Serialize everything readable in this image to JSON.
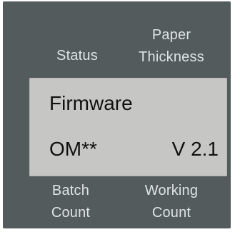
{
  "keys": {
    "status": "Status",
    "paper_thickness": [
      "Paper",
      "Thickness"
    ],
    "batch_count": [
      "Batch",
      "Count"
    ],
    "working_count": [
      "Working",
      "Count"
    ]
  },
  "display": {
    "title": "Firmware",
    "model": "OM**",
    "version": "V 2.1"
  },
  "colors": {
    "bezel": "#545b5d",
    "lcd_background": "#c6c6c5",
    "lcd_text": "#111111",
    "key_label_text": "#dfe3e3"
  }
}
